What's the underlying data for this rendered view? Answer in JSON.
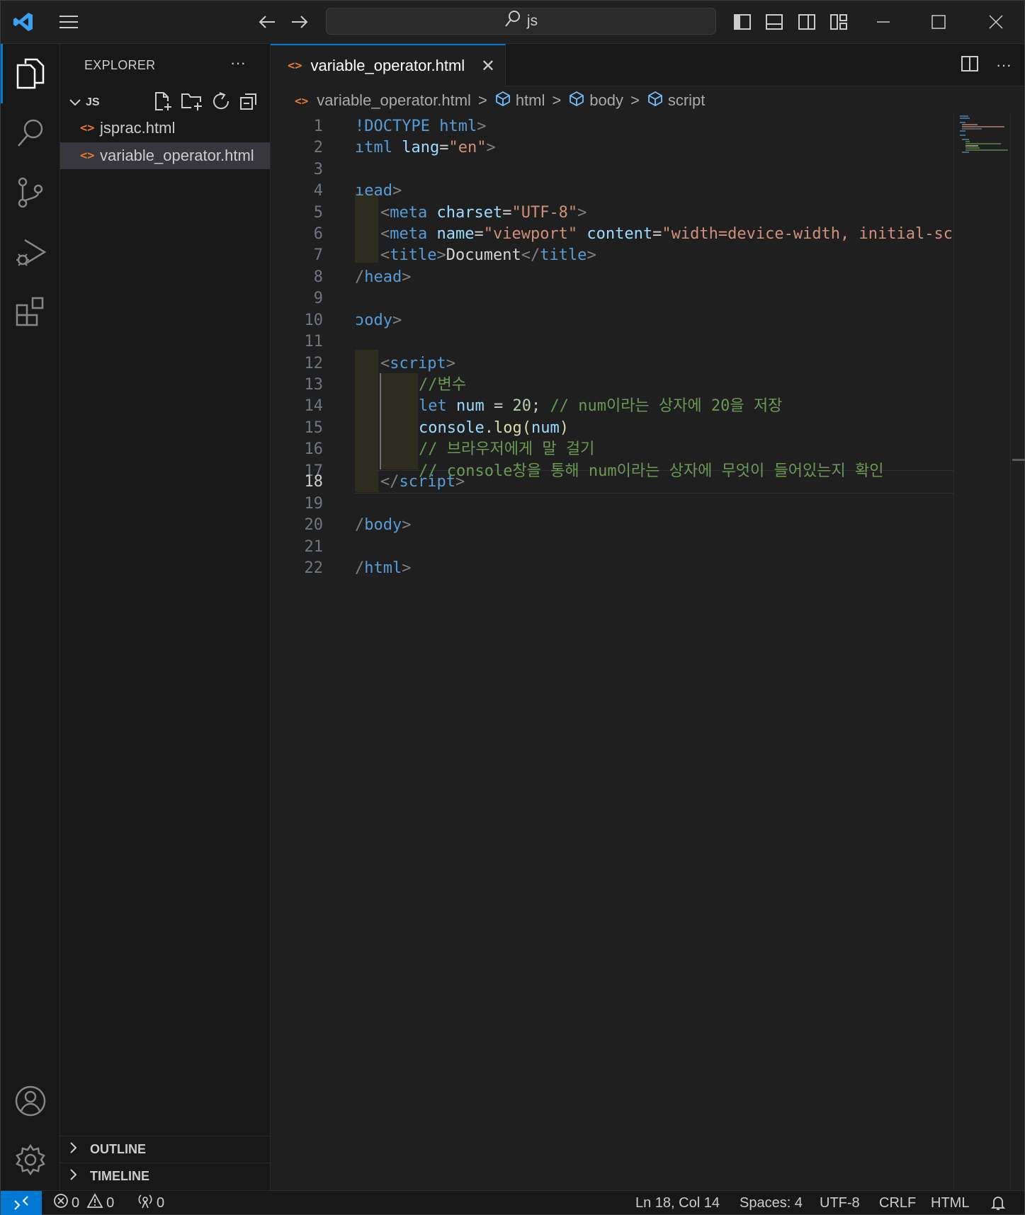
{
  "titlebar": {
    "search_text": "js",
    "icons": [
      "vscode-logo-icon",
      "menu-icon",
      "back-arrow-icon",
      "forward-arrow-icon",
      "search-icon",
      "toggle-primary-sidebar-icon",
      "toggle-panel-icon",
      "toggle-secondary-sidebar-icon",
      "customize-layout-icon",
      "minimize-icon",
      "maximize-icon",
      "close-window-icon"
    ]
  },
  "activity_bar": {
    "items": [
      "explorer-icon",
      "search-icon",
      "source-control-icon",
      "run-debug-icon",
      "extensions-icon"
    ],
    "bottom": [
      "accounts-icon",
      "manage-gear-icon"
    ]
  },
  "sidebar": {
    "title": "EXPLORER",
    "more": "···",
    "folder": "JS",
    "files": [
      {
        "name": "jsprac.html",
        "icon": "<>"
      },
      {
        "name": "variable_operator.html",
        "icon": "<>"
      }
    ],
    "sections": [
      "OUTLINE",
      "TIMELINE"
    ]
  },
  "editor": {
    "tab_label": "variable_operator.html",
    "tab_icon": "<>",
    "close": "✕",
    "breadcrumbs": {
      "file": "variable_operator.html",
      "items": [
        "html",
        "body",
        "script"
      ]
    },
    "current_line": 18
  },
  "code_lines": [
    {
      "n": "1"
    },
    {
      "n": "2"
    },
    {
      "n": "3"
    },
    {
      "n": "4"
    },
    {
      "n": "5"
    },
    {
      "n": "6"
    },
    {
      "n": "7"
    },
    {
      "n": "8"
    },
    {
      "n": "9"
    },
    {
      "n": "10"
    },
    {
      "n": "11"
    },
    {
      "n": "12"
    },
    {
      "n": "13"
    },
    {
      "n": "14"
    },
    {
      "n": "15"
    },
    {
      "n": "16"
    },
    {
      "n": "17"
    },
    {
      "n": "18"
    },
    {
      "n": "19"
    },
    {
      "n": "20"
    },
    {
      "n": "21"
    },
    {
      "n": "22"
    }
  ],
  "code": {
    "l1a": "!DOCTYPE",
    "l1b": " html",
    "l1c": ">",
    "l2a": "ıtml",
    "l2b": " lang",
    "l2c": "=",
    "l2d": "\"en\"",
    "l2e": ">",
    "l4a": "ıead",
    "l4b": ">",
    "l5a": "<",
    "l5b": "meta",
    "l5c": " charset",
    "l5d": "=",
    "l5e": "\"UTF-8\"",
    "l5f": ">",
    "l6a": "<",
    "l6b": "meta",
    "l6c": " name",
    "l6d": "=",
    "l6e": "\"viewport\"",
    "l6f": " content",
    "l6g": "=",
    "l6h": "\"width=device-width, initial-sc",
    "l7a": "<",
    "l7b": "title",
    "l7c": ">",
    "l7d": "Document",
    "l7e": "</",
    "l7f": "title",
    "l7g": ">",
    "l8a": "/",
    "l8b": "head",
    "l8c": ">",
    "l10a": "ɔody",
    "l10b": ">",
    "l12a": "<",
    "l12b": "script",
    "l12c": ">",
    "l13a": "//변수",
    "l14a": "let",
    "l14b": " num",
    "l14c": " = ",
    "l14d": "20",
    "l14e": "; ",
    "l14f": "// num이라는 상자에 20을 저장",
    "l15a": "console",
    "l15b": ".",
    "l15c": "log",
    "l15d": "(",
    "l15e": "num",
    "l15f": ")",
    "l16a": "// 브라우저에게 말 걸기",
    "l17a": "// console창을 통해 num이라는 상자에 무엇이 들어있는지 확인",
    "l18a": "</",
    "l18b": "script",
    "l18c": ">",
    "l20a": "/",
    "l20b": "body",
    "l20c": ">",
    "l22a": "/",
    "l22b": "html",
    "l22c": ">"
  },
  "statusbar": {
    "errors": "0",
    "warnings": "0",
    "ports": "0",
    "position": "Ln 18, Col 14",
    "spaces": "Spaces: 4",
    "encoding": "UTF-8",
    "eol": "CRLF",
    "language": "HTML"
  },
  "colors": {
    "accent": "#0078d4",
    "html_file_icon": "#e37933"
  }
}
